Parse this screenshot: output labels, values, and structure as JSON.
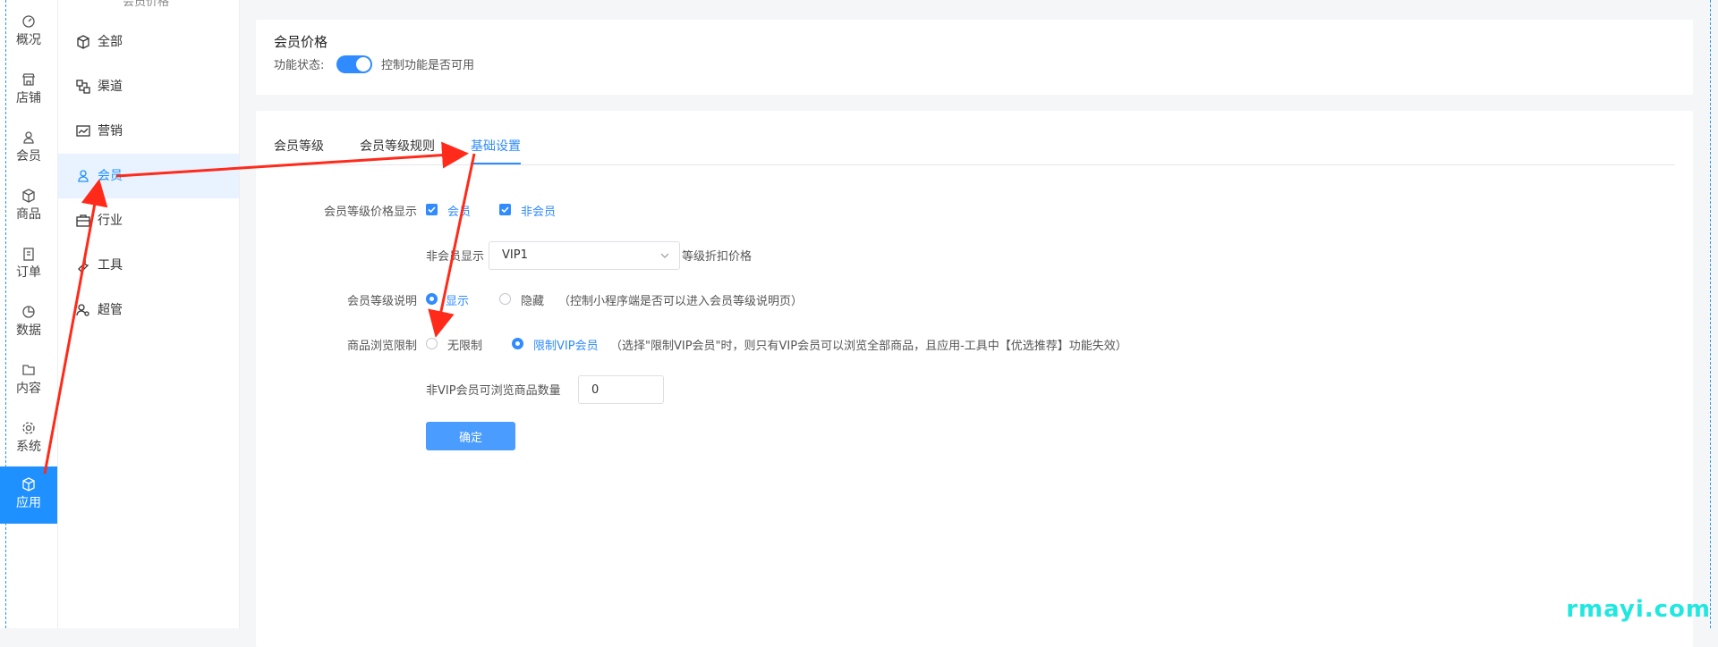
{
  "rail": {
    "items": [
      {
        "label": "概况",
        "icon": "dashboard-icon"
      },
      {
        "label": "店铺",
        "icon": "store-icon"
      },
      {
        "label": "会员",
        "icon": "user-icon"
      },
      {
        "label": "商品",
        "icon": "cube-icon"
      },
      {
        "label": "订单",
        "icon": "clipboard-icon"
      },
      {
        "label": "数据",
        "icon": "pie-icon"
      },
      {
        "label": "内容",
        "icon": "folder-icon"
      },
      {
        "label": "系统",
        "icon": "gear-icon"
      },
      {
        "label": "应用",
        "icon": "cube-icon"
      }
    ]
  },
  "sub": {
    "header": "会员价格",
    "items": [
      {
        "label": "全部",
        "icon": "cube-icon"
      },
      {
        "label": "渠道",
        "icon": "channel-icon"
      },
      {
        "label": "营销",
        "icon": "chart-icon"
      },
      {
        "label": "会员",
        "icon": "user-icon"
      },
      {
        "label": "行业",
        "icon": "briefcase-icon"
      },
      {
        "label": "工具",
        "icon": "tool-icon"
      },
      {
        "label": "超管",
        "icon": "admin-icon"
      }
    ]
  },
  "top": {
    "title": "会员价格",
    "status_label": "功能状态:",
    "status_desc": "控制功能是否可用"
  },
  "tabs": [
    "会员等级",
    "会员等级规则",
    "基础设置"
  ],
  "form": {
    "price_display_label": "会员等级价格显示",
    "chk_member": "会员",
    "chk_nonmember": "非会员",
    "nonmember_show_label": "非会员显示",
    "nonmember_select": "VIP1",
    "nonmember_suffix": "等级折扣价格",
    "level_desc_label": "会员等级说明",
    "radio_show": "显示",
    "radio_hide": "隐藏",
    "level_desc_hint": "（控制小程序端是否可以进入会员等级说明页）",
    "browse_limit_label": "商品浏览限制",
    "radio_unlimited": "无限制",
    "radio_vip": "限制VIP会员",
    "browse_hint": "（选择\"限制VIP会员\"时，则只有VIP会员可以浏览全部商品，且应用-工具中【优选推荐】功能失效）",
    "count_label": "非VIP会员可浏览商品数量",
    "count_value": "0",
    "confirm": "确定"
  },
  "watermark": "rmayi.com",
  "colors": {
    "accent": "#2f8bff",
    "rail_active": "#1e90ff",
    "arrow": "#ff2a1a"
  }
}
